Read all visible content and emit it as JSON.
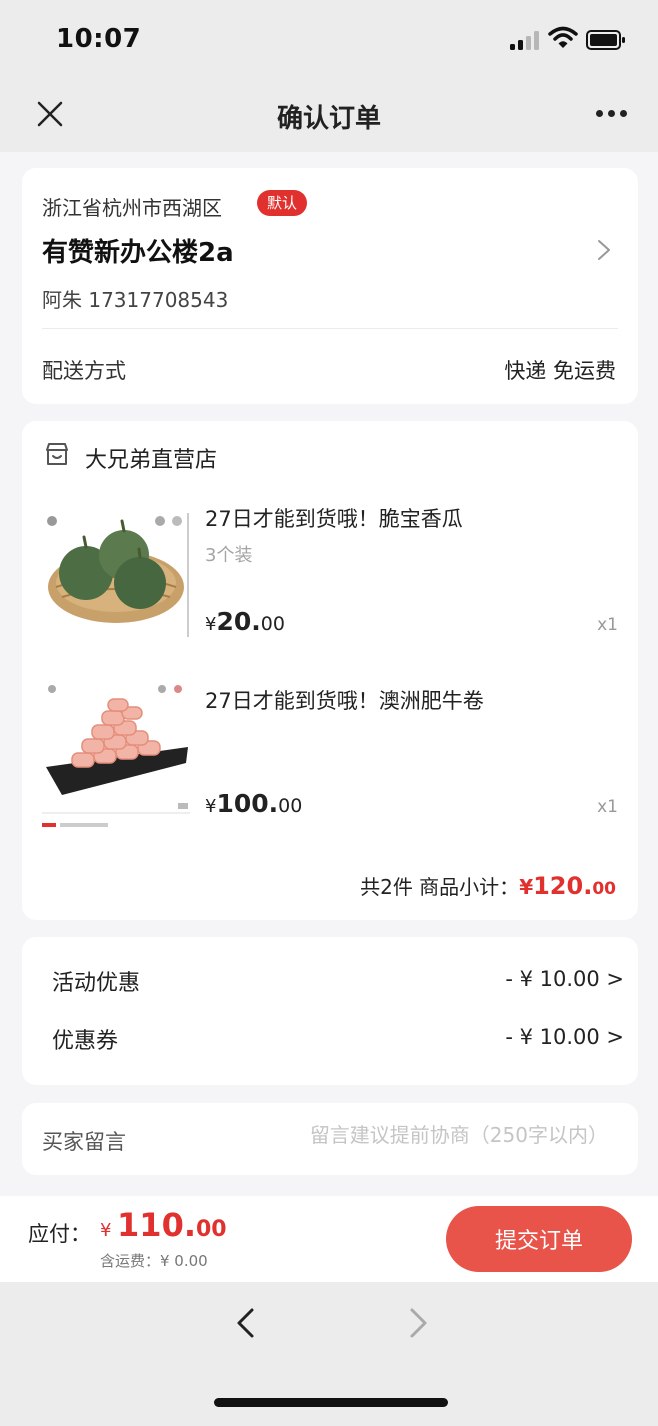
{
  "status_bar": {
    "time": "10:07"
  },
  "nav": {
    "title": "确认订单"
  },
  "address": {
    "region": "浙江省杭州市西湖区",
    "default_badge": "默认",
    "street": "有赞新办公楼2a",
    "contact": "阿朱 17317708543",
    "shipping_label": "配送方式",
    "shipping_value": "快递 免运费"
  },
  "shop": {
    "name": "大兄弟直营店",
    "products": [
      {
        "title": "27日才能到货哦！脆宝香瓜",
        "spec": "3个装",
        "currency": "¥",
        "price_int": "20.",
        "price_dec": "00",
        "qty": "x1",
        "image": "melon-photo"
      },
      {
        "title": "27日才能到货哦！澳洲肥牛卷",
        "spec": "",
        "currency": "¥",
        "price_int": "100.",
        "price_dec": "00",
        "qty": "x1",
        "image": "beef-roll-photo"
      }
    ],
    "subtotal_label": "共2件  商品小计：",
    "subtotal_currency": "¥",
    "subtotal_int": "120.",
    "subtotal_dec": "00"
  },
  "discounts": [
    {
      "label": "活动优惠",
      "amount": "- ¥ 10.00 >"
    },
    {
      "label": "优惠券",
      "amount": "- ¥ 10.00 >"
    }
  ],
  "note": {
    "label": "买家留言",
    "placeholder": "留言建议提前协商（250字以内）",
    "value": ""
  },
  "footer": {
    "due_label": "应付：",
    "due_currency": "¥",
    "due_int": "110.",
    "due_dec": "00",
    "shipping_fee": "含运费：¥ 0.00",
    "submit_label": "提交订单"
  },
  "colors": {
    "accent": "#e0312e",
    "button": "#e8534a",
    "background": "#f5f5f7"
  }
}
